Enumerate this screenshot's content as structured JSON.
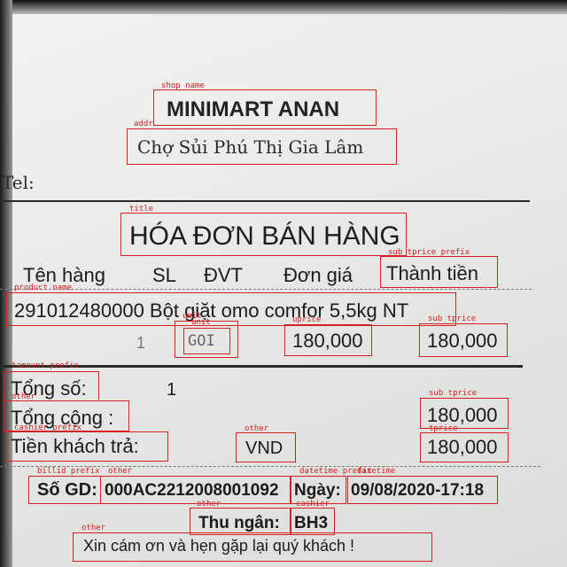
{
  "receipt": {
    "shop_name": "MINIMART ANAN",
    "address": "Chợ Sủi Phú Thị Gia Lâm",
    "tel_label": "Tel:",
    "title": "HÓA ĐƠN BÁN HÀNG",
    "columns": {
      "item": "Tên hàng",
      "qty": "SL",
      "unit": "ĐVT",
      "unit_price": "Đơn giá",
      "total": "Thành tiền"
    },
    "item": {
      "name": "291012480000 Bột giặt omo comfor 5,5kg NT",
      "qty": "1",
      "unit": "GOI",
      "unit_price": "180,000",
      "subtotal": "180,000"
    },
    "total_qty_label": "Tổng số:",
    "total_qty": "1",
    "total_label": "Tổng cộng :",
    "total_value": "180,000",
    "paid_label": "Tiền khách trả:",
    "currency": "VND",
    "paid_value": "180,000",
    "bill_id_label": "Số GD:",
    "bill_id": "000AC2212008001092",
    "date_label": "Ngày:",
    "date_value": "09/08/2020-17:18",
    "cashier_label": "Thu ngân:",
    "cashier": "BH3",
    "footer": "Xin cám ơn và hẹn gặp lại quý khách !"
  },
  "annotations": {
    "shop_name": "shop name",
    "addr": "addr",
    "title": "title",
    "sub_tprice_prefix": "sub tprice prefix",
    "product_name": "product name",
    "unit": "unit",
    "unit_2": "unit",
    "uprice": "uprice",
    "sub_tprice": "sub tprice",
    "tamount_prefix": "tamount prefix",
    "other": "other",
    "sub_tprice_2": "sub tprice",
    "cashier_prefix": "cashier prefix",
    "other_2": "other",
    "tprice": "tprice",
    "billid_prefix": "billid prefix",
    "other_3": "other",
    "datetime_prefix": "datetime prefix",
    "datetime": "datetime",
    "other_4": "other",
    "cashier": "cashier",
    "other_5": "other"
  },
  "colors": {
    "annotation": "#d42020",
    "paper": "#ececea",
    "ink": "#1b1b1b"
  }
}
